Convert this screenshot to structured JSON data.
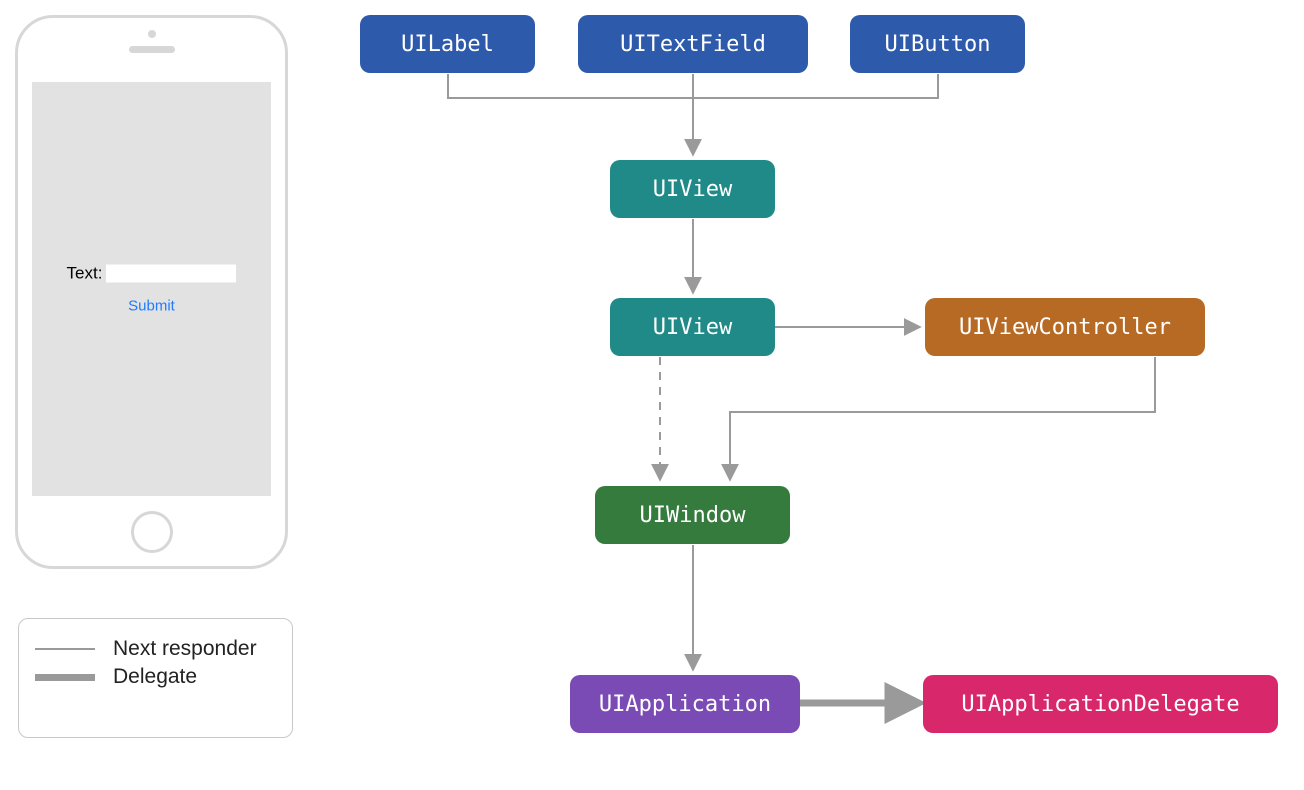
{
  "phone": {
    "label": "Text:",
    "submit": "Submit"
  },
  "legend": {
    "next": "Next responder",
    "delegate": "Delegate"
  },
  "nodes": {
    "uilabel": "UILabel",
    "uitextfield": "UITextField",
    "uibutton": "UIButton",
    "uiview1": "UIView",
    "uiview2": "UIView",
    "uiviewcontroller": "UIViewController",
    "uiwindow": "UIWindow",
    "uiapplication": "UIApplication",
    "uiapplicationdelegate": "UIApplicationDelegate"
  },
  "colors": {
    "blue": "#2e5aab",
    "teal": "#1f8a87",
    "brown": "#b76a23",
    "green": "#357b3d",
    "purple": "#7a4bb5",
    "pink": "#d8286b",
    "line": "#9a9a9a"
  }
}
